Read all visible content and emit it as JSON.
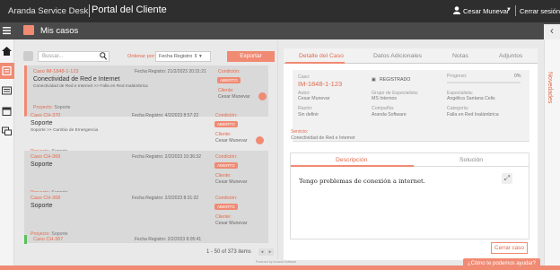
{
  "app": {
    "brand": "Aranda Service Desk",
    "title": "Portal del Cliente"
  },
  "user": {
    "name": "Cesar Munevar",
    "logout": "Cerrar sesión"
  },
  "section": {
    "title": "Mis casos"
  },
  "rail": {
    "novedades": "Novedades"
  },
  "toolbar": {
    "search_placeholder": "Buscar...",
    "order_label": "Ordenar por:",
    "order_value": "Fecha Registro",
    "export_label": "Exportar"
  },
  "cases": [
    {
      "id": "Caso IM-1848-1-123",
      "date": "Fecha Registro: 21/2/2023 20:31:21",
      "title": "Conectividad de Red e Internet",
      "desc": "Conectividad de Red e Internet >> Falla en Red Inalámbrica",
      "project_label": "Proyecto:",
      "project": "Soporte",
      "cond_label": "Condición:",
      "badge": "ABIERTO",
      "client_label": "Cliente:",
      "client": "Cesar Munevar"
    },
    {
      "id": "Caso CH-370",
      "date": "Fecha Registro: 4/2/2023 8:57:22",
      "title": "Soporte",
      "desc": "Soporte >> Cambio de Emergencia",
      "project_label": "Proyecto:",
      "project": "Soporte",
      "cond_label": "Condición:",
      "badge": "ABIERTO",
      "client_label": "Cliente:",
      "client": "Cesar Munevar"
    },
    {
      "id": "Caso CH-369",
      "date": "Fecha Registro: 2/2/2023 10:36:32",
      "title": "Soporte",
      "desc": "",
      "project_label": "Proyecto:",
      "project": "Soporte",
      "cond_label": "Condición:",
      "badge": "ABIERTO",
      "client_label": "Cliente:",
      "client": "Cesar Munevar"
    },
    {
      "id": "Caso CH-368",
      "date": "Fecha Registro: 2/2/2023 8:31:32",
      "title": "Soporte",
      "desc": "",
      "project_label": "Proyecto:",
      "project": "Soporte",
      "cond_label": "Condición:",
      "badge": "ABIERTO",
      "client_label": "Cliente:",
      "client": "Cesar Munevar"
    }
  ],
  "last_case": {
    "id": "Caso CH-367",
    "date": "Fecha Registro: 2/2/2023 8:05:41"
  },
  "pager": {
    "text": "1 - 50 of 373 items"
  },
  "powered": "Powered by Aranda Software",
  "tabs": [
    "Detalle del Caso",
    "Datos Adicionales",
    "Notas",
    "Adjuntos"
  ],
  "detail": {
    "case_label": "Caso:",
    "case_id": "IM-1848-1-123",
    "status": "REGISTRADO",
    "progress_label": "Progreso:",
    "progress_value": "0%",
    "progress_fraction": 0,
    "author_label": "Autor:",
    "author": "Cesar Munevar",
    "group_label": "Grupo de Especialista:",
    "group": "MS Internos",
    "specialist_label": "Especialista:",
    "specialist": "Angélica Santana Celis",
    "reason_label": "Razón:",
    "reason": "Sin definir",
    "company_label": "Compañía:",
    "company": "Aranda Software",
    "category_label": "Categoría:",
    "category": "Falla en Red Inalámbrica",
    "service_label": "Servicio:",
    "service": "Conectividad de Red e Internet"
  },
  "desc_tabs": [
    "Descripción",
    "Solución"
  ],
  "description": "Tengo problemas de conexión a internet.",
  "close_case": "Cerrar caso",
  "help": "¿Cómo te podemos ayudar?",
  "colors": {
    "accent": "#f08a73",
    "dark": "#2e2e2e"
  }
}
